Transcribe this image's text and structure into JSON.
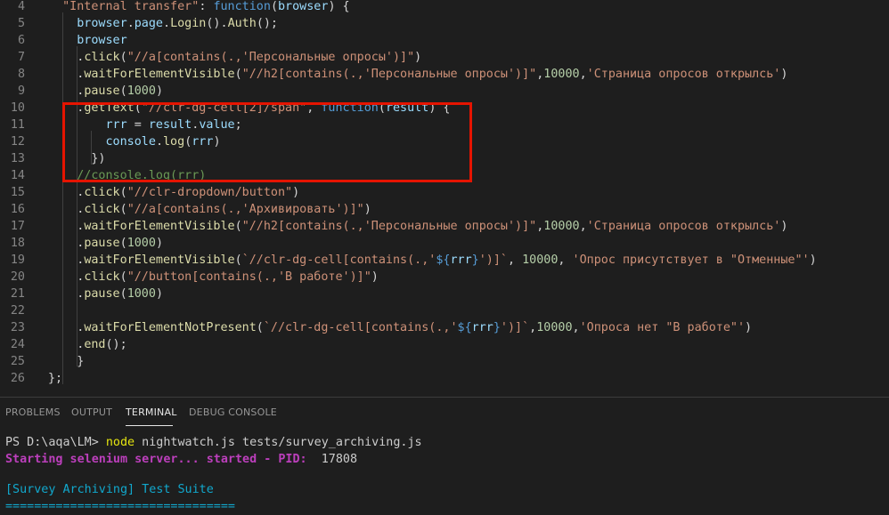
{
  "editor": {
    "lines": [
      {
        "num": "4",
        "indent": 0,
        "tokens": [
          {
            "t": "  ",
            "c": "t-punc"
          },
          {
            "t": "\"Internal transfer\"",
            "c": "t-str"
          },
          {
            "t": ": ",
            "c": "t-punc"
          },
          {
            "t": "function",
            "c": "t-kw"
          },
          {
            "t": "(",
            "c": "t-punc"
          },
          {
            "t": "browser",
            "c": "t-var"
          },
          {
            "t": ") {",
            "c": "t-punc"
          }
        ]
      },
      {
        "num": "5",
        "tokens": [
          {
            "t": "    ",
            "c": "t-punc"
          },
          {
            "t": "browser",
            "c": "t-var"
          },
          {
            "t": ".",
            "c": "t-punc"
          },
          {
            "t": "page",
            "c": "t-var"
          },
          {
            "t": ".",
            "c": "t-punc"
          },
          {
            "t": "Login",
            "c": "t-prop"
          },
          {
            "t": "().",
            "c": "t-punc"
          },
          {
            "t": "Auth",
            "c": "t-prop"
          },
          {
            "t": "();",
            "c": "t-punc"
          }
        ]
      },
      {
        "num": "6",
        "tokens": [
          {
            "t": "    ",
            "c": "t-punc"
          },
          {
            "t": "browser",
            "c": "t-var"
          }
        ]
      },
      {
        "num": "7",
        "tokens": [
          {
            "t": "    .",
            "c": "t-punc"
          },
          {
            "t": "click",
            "c": "t-prop"
          },
          {
            "t": "(",
            "c": "t-punc"
          },
          {
            "t": "\"//a[contains(.,'Персональные опросы')]\"",
            "c": "t-str"
          },
          {
            "t": ")",
            "c": "t-punc"
          }
        ]
      },
      {
        "num": "8",
        "tokens": [
          {
            "t": "    .",
            "c": "t-punc"
          },
          {
            "t": "waitForElementVisible",
            "c": "t-prop"
          },
          {
            "t": "(",
            "c": "t-punc"
          },
          {
            "t": "\"//h2[contains(.,'Персональные опросы')]\"",
            "c": "t-str"
          },
          {
            "t": ",",
            "c": "t-punc"
          },
          {
            "t": "10000",
            "c": "t-num"
          },
          {
            "t": ",",
            "c": "t-punc"
          },
          {
            "t": "'Страница опросов открылсь'",
            "c": "t-str"
          },
          {
            "t": ")",
            "c": "t-punc"
          }
        ]
      },
      {
        "num": "9",
        "tokens": [
          {
            "t": "    .",
            "c": "t-punc"
          },
          {
            "t": "pause",
            "c": "t-prop"
          },
          {
            "t": "(",
            "c": "t-punc"
          },
          {
            "t": "1000",
            "c": "t-num"
          },
          {
            "t": ")",
            "c": "t-punc"
          }
        ]
      },
      {
        "num": "10",
        "tokens": [
          {
            "t": "    .",
            "c": "t-punc"
          },
          {
            "t": "getText",
            "c": "t-prop"
          },
          {
            "t": "(",
            "c": "t-punc"
          },
          {
            "t": "\"//clr-dg-cell[2]/span\"",
            "c": "t-str"
          },
          {
            "t": ", ",
            "c": "t-punc"
          },
          {
            "t": "function",
            "c": "t-kw"
          },
          {
            "t": "(",
            "c": "t-punc"
          },
          {
            "t": "result",
            "c": "t-var"
          },
          {
            "t": ") {",
            "c": "t-punc"
          }
        ]
      },
      {
        "num": "11",
        "tokens": [
          {
            "t": "        ",
            "c": "t-punc"
          },
          {
            "t": "rrr",
            "c": "t-var"
          },
          {
            "t": " = ",
            "c": "t-punc"
          },
          {
            "t": "result",
            "c": "t-var"
          },
          {
            "t": ".",
            "c": "t-punc"
          },
          {
            "t": "value",
            "c": "t-var"
          },
          {
            "t": ";",
            "c": "t-punc"
          }
        ]
      },
      {
        "num": "12",
        "tokens": [
          {
            "t": "        ",
            "c": "t-punc"
          },
          {
            "t": "console",
            "c": "t-var"
          },
          {
            "t": ".",
            "c": "t-punc"
          },
          {
            "t": "log",
            "c": "t-prop"
          },
          {
            "t": "(",
            "c": "t-punc"
          },
          {
            "t": "rrr",
            "c": "t-var"
          },
          {
            "t": ")",
            "c": "t-punc"
          }
        ]
      },
      {
        "num": "13",
        "tokens": [
          {
            "t": "      })",
            "c": "t-punc"
          }
        ]
      },
      {
        "num": "14",
        "tokens": [
          {
            "t": "    //console.log(rrr)",
            "c": "t-cmt"
          }
        ]
      },
      {
        "num": "15",
        "tokens": [
          {
            "t": "    .",
            "c": "t-punc"
          },
          {
            "t": "click",
            "c": "t-prop"
          },
          {
            "t": "(",
            "c": "t-punc"
          },
          {
            "t": "\"//clr-dropdown/button\"",
            "c": "t-str"
          },
          {
            "t": ")",
            "c": "t-punc"
          }
        ]
      },
      {
        "num": "16",
        "tokens": [
          {
            "t": "    .",
            "c": "t-punc"
          },
          {
            "t": "click",
            "c": "t-prop"
          },
          {
            "t": "(",
            "c": "t-punc"
          },
          {
            "t": "\"//a[contains(.,'Архивировать')]\"",
            "c": "t-str"
          },
          {
            "t": ")",
            "c": "t-punc"
          }
        ]
      },
      {
        "num": "17",
        "tokens": [
          {
            "t": "    .",
            "c": "t-punc"
          },
          {
            "t": "waitForElementVisible",
            "c": "t-prop"
          },
          {
            "t": "(",
            "c": "t-punc"
          },
          {
            "t": "\"//h2[contains(.,'Персональные опросы')]\"",
            "c": "t-str"
          },
          {
            "t": ",",
            "c": "t-punc"
          },
          {
            "t": "10000",
            "c": "t-num"
          },
          {
            "t": ",",
            "c": "t-punc"
          },
          {
            "t": "'Страница опросов открылсь'",
            "c": "t-str"
          },
          {
            "t": ")",
            "c": "t-punc"
          }
        ]
      },
      {
        "num": "18",
        "tokens": [
          {
            "t": "    .",
            "c": "t-punc"
          },
          {
            "t": "pause",
            "c": "t-prop"
          },
          {
            "t": "(",
            "c": "t-punc"
          },
          {
            "t": "1000",
            "c": "t-num"
          },
          {
            "t": ")",
            "c": "t-punc"
          }
        ]
      },
      {
        "num": "19",
        "tokens": [
          {
            "t": "    .",
            "c": "t-punc"
          },
          {
            "t": "waitForElementVisible",
            "c": "t-prop"
          },
          {
            "t": "(",
            "c": "t-punc"
          },
          {
            "t": "`//clr-dg-cell[contains(.,'",
            "c": "t-str"
          },
          {
            "t": "${",
            "c": "t-tpl"
          },
          {
            "t": "rrr",
            "c": "t-var"
          },
          {
            "t": "}",
            "c": "t-tpl"
          },
          {
            "t": "')]`",
            "c": "t-str"
          },
          {
            "t": ", ",
            "c": "t-punc"
          },
          {
            "t": "10000",
            "c": "t-num"
          },
          {
            "t": ", ",
            "c": "t-punc"
          },
          {
            "t": "'Опрос присутствует в \"Отменные\"'",
            "c": "t-str"
          },
          {
            "t": ")",
            "c": "t-punc"
          }
        ]
      },
      {
        "num": "20",
        "tokens": [
          {
            "t": "    .",
            "c": "t-punc"
          },
          {
            "t": "click",
            "c": "t-prop"
          },
          {
            "t": "(",
            "c": "t-punc"
          },
          {
            "t": "\"//button[contains(.,'В работе')]\"",
            "c": "t-str"
          },
          {
            "t": ")",
            "c": "t-punc"
          }
        ]
      },
      {
        "num": "21",
        "tokens": [
          {
            "t": "    .",
            "c": "t-punc"
          },
          {
            "t": "pause",
            "c": "t-prop"
          },
          {
            "t": "(",
            "c": "t-punc"
          },
          {
            "t": "1000",
            "c": "t-num"
          },
          {
            "t": ")",
            "c": "t-punc"
          }
        ]
      },
      {
        "num": "22",
        "tokens": []
      },
      {
        "num": "23",
        "tokens": [
          {
            "t": "    .",
            "c": "t-punc"
          },
          {
            "t": "waitForElementNotPresent",
            "c": "t-prop"
          },
          {
            "t": "(",
            "c": "t-punc"
          },
          {
            "t": "`//clr-dg-cell[contains(.,'",
            "c": "t-str"
          },
          {
            "t": "${",
            "c": "t-tpl"
          },
          {
            "t": "rrr",
            "c": "t-var"
          },
          {
            "t": "}",
            "c": "t-tpl"
          },
          {
            "t": "')]`",
            "c": "t-str"
          },
          {
            "t": ",",
            "c": "t-punc"
          },
          {
            "t": "10000",
            "c": "t-num"
          },
          {
            "t": ",",
            "c": "t-punc"
          },
          {
            "t": "'Опроса нет \"В работе\"'",
            "c": "t-str"
          },
          {
            "t": ")",
            "c": "t-punc"
          }
        ]
      },
      {
        "num": "24",
        "tokens": [
          {
            "t": "    .",
            "c": "t-punc"
          },
          {
            "t": "end",
            "c": "t-prop"
          },
          {
            "t": "();",
            "c": "t-punc"
          }
        ]
      },
      {
        "num": "25",
        "tokens": [
          {
            "t": "    }",
            "c": "t-punc"
          }
        ]
      },
      {
        "num": "26",
        "tokens": [
          {
            "t": "};",
            "c": "t-punc"
          }
        ]
      }
    ]
  },
  "panel": {
    "tabs": [
      {
        "label": "PROBLEMS",
        "active": false
      },
      {
        "label": "OUTPUT",
        "active": false
      },
      {
        "label": "TERMINAL",
        "active": true
      },
      {
        "label": "DEBUG CONSOLE",
        "active": false
      }
    ],
    "terminal": {
      "prompt": "PS D:\\aqa\\LM> ",
      "command": "node",
      "args": " nightwatch.js tests/survey_archiving.js",
      "selenium_msg": "Starting selenium server... started - PID:  ",
      "pid": "17808",
      "suite": "[Survey Archiving] Test Suite",
      "separator": "================================"
    }
  },
  "colors": {
    "highlight_border": "#e51400",
    "background": "#1e1e1e"
  }
}
